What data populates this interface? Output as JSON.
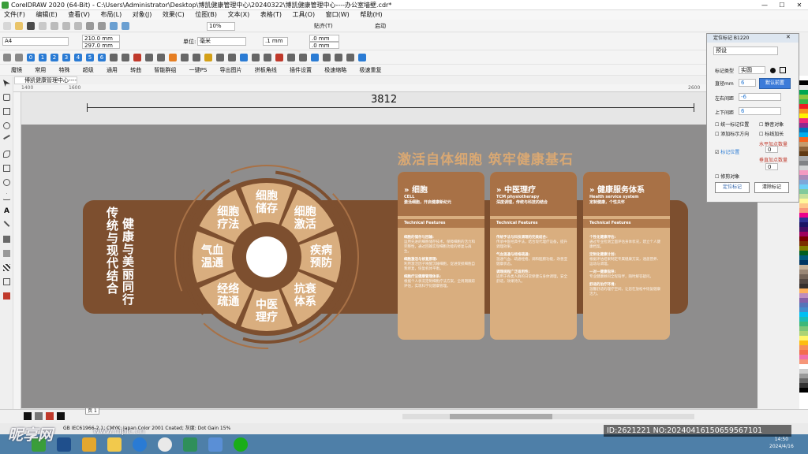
{
  "window": {
    "title": "CorelDRAW 2020 (64-Bit) - C:\\Users\\Administrator\\Desktop\\博凯健康管理中心\\20240322\\博凯健康管理中心----办公室墙壁.cdr*",
    "minimize": "—",
    "maximize": "☐",
    "close": "✕"
  },
  "menu": [
    "文件(F)",
    "编辑(E)",
    "查看(V)",
    "布局(L)",
    "对象(J)",
    "效果(C)",
    "位图(B)",
    "文本(X)",
    "表格(T)",
    "工具(O)",
    "窗口(W)",
    "帮助(H)"
  ],
  "toolbar1": {
    "zoom": "10%",
    "snap": "贴齐(T)",
    "launch": "启动"
  },
  "toolbar2": {
    "page_size": "A4",
    "width": "210.0 mm",
    "height": "297.0 mm",
    "units_label": "单位:",
    "units": "毫米",
    "nudge": ".1 mm",
    "dup_x": ".0 mm",
    "dup_y": ".0 mm"
  },
  "toolbar3": {
    "numbers": [
      "0",
      "1",
      "2",
      "3",
      "4",
      "5",
      "6"
    ]
  },
  "toolbar4": [
    "魔镜",
    "常用",
    "特殊",
    "超级",
    "通用",
    "转曲",
    "智能群组",
    "一键PS",
    "导出图片",
    "拼板角线",
    "插件设置",
    "极速缩略",
    "极速重复"
  ],
  "document_tab": "博凯健康管理中心----...",
  "page_tab": "页 1",
  "ruler": {
    "left": "1400",
    "mid": "1600",
    "right": "2600"
  },
  "dimension": "3812",
  "design": {
    "headline": "激活自体细胞   筑牢健康基石",
    "vertical_line1": "传统与现代结合",
    "vertical_line2": "健康与美丽同行",
    "wheel_segments": [
      "细胞\n储存",
      "细胞\n激活",
      "疾病\n预防",
      "抗衰\n体系",
      "中医\n理疗",
      "经络\n疏通",
      "气血\n温通",
      "细胞\n疗法"
    ],
    "cards": [
      {
        "title": "» 细胞",
        "subtitle": "CELL",
        "tagline": "激活细胞，开启健康新纪元",
        "tech": "Technical Features",
        "sections": [
          {
            "head": "细胞的储存与回输:",
            "body": "运用先进的细胞储存技术，保障细胞的活力和完整性，通过回输实现细胞功能的修复与再生。"
          },
          {
            "head": "细胞激活与修复原理:",
            "body": "利用激活因子唤醒沉睡细胞，促进受损细胞自我修复，恢复机体平衡。"
          },
          {
            "head": "细胞疗法健康管理体系:",
            "body": "根据个人状况定制细胞疗法方案，全周期跟踪评估，实现科学化健康管理。"
          }
        ]
      },
      {
        "title": "» 中医理疗",
        "subtitle": "TCM physiotherapy",
        "tagline": "深度调理，传统与科技的结合",
        "tech": "Technical Features",
        "sections": [
          {
            "head": "传统手法与科技调理的完美结合:",
            "body": "传承中医经典手法，结合现代理疗设备，提升调理效果。"
          },
          {
            "head": "气血温通与经络疏通:",
            "body": "温通气血、疏通经络，调和脏腑功能，改善亚健康状态。"
          },
          {
            "head": "调理规程广泛适用性:",
            "body": "适用于各类人群的日常保健与身体调理，安全舒适，效果持久。"
          }
        ]
      },
      {
        "title": "» 健康服务体系",
        "subtitle": "Health service system",
        "tagline": "定制健康，个性关怀",
        "tech": "Technical Features",
        "sections": [
          {
            "head": "个性化健康评估:",
            "body": "通过专业检测全面评估身体状况，建立个人健康档案。"
          },
          {
            "head": "定制化健康计划:",
            "body": "根据评估结果制定专属健康方案，涵盖营养、运动与调理。"
          },
          {
            "head": "一对一健康指导:",
            "body": "专业健康顾问全程陪伴，随时解答疑问。"
          },
          {
            "head": "舒适的治疗环境:",
            "body": "温馨舒适的理疗空间，让您在放松中恢复健康活力。"
          }
        ]
      }
    ]
  },
  "docker": {
    "title": "定位标记 B1220",
    "preset": "预设",
    "mark_type_label": "标记类型",
    "mark_type": "实圆",
    "diameter_label": "直径mm",
    "diameter": "6",
    "default_btn": "默认前置",
    "lr_margin_label": "左右间距",
    "lr_margin": "-6",
    "tb_margin_label": "上下间距",
    "tb_margin": "6",
    "options": [
      "统一标记位置",
      "添加标示方向",
      "标记位置",
      "静音对象",
      "标线加长",
      "水平加点数量",
      "垂直加点数量",
      "修剪对象"
    ],
    "hcount": "0",
    "vcount": "0",
    "mark_btn": "定位标记",
    "clear_btn": "清除标记"
  },
  "infobar": "GB IEC61966-2.1; CMYK: Japan Color 2001 Coated; 灰度: Dot Gain 15%",
  "watermark": {
    "site": "昵享网",
    "url": "www.nipic.cn",
    "id": "ID:2621221 NO:20240416150659567101"
  },
  "clock": {
    "time": "14:50",
    "date": "2024/4/16"
  },
  "colors": {
    "canvas_gray": "#8e8d8d",
    "brown_dark": "#7d4f2f",
    "brown_mid": "#a87146",
    "tan": "#d9ae7f",
    "headline": "#d9a873"
  }
}
